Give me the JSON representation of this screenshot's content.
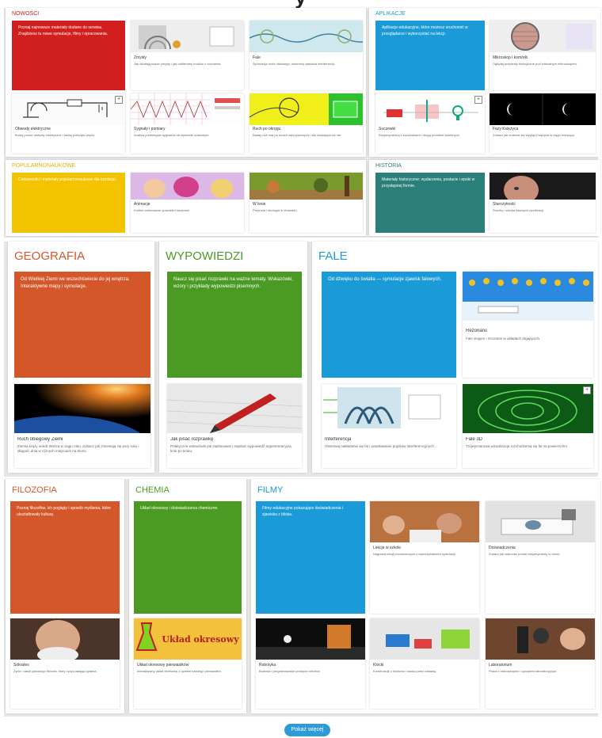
{
  "top_heading": "y",
  "colors": {
    "red": "#d11f1f",
    "blue": "#1a9bd7",
    "yellow": "#f3c300",
    "teal": "#2a7f7a",
    "orange": "#d4572a",
    "green": "#4a9a24",
    "button": "#2f9ad6"
  },
  "row1": {
    "nowosci": {
      "title": "NOWOŚCI",
      "intro": "Poznaj najnowsze materiały dodane do serwisu. Znajdziesz tu nowe symulacje, filmy i opracowania.",
      "cards": [
        {
          "title": "Zmysły",
          "desc": "Jak działają nasze zmysły i jak odbieramy bodźce z otoczenia.",
          "icon": "senses-diagram"
        },
        {
          "title": "Fale",
          "desc": "Symulacja ruchu falowego, obserwuj zjawiska interferencji.",
          "icon": "wave-track"
        },
        {
          "title": "Obwody elektryczne",
          "desc": "Buduj proste obwody elektryczne i badaj przepływ prądu.",
          "icon": "circuit"
        },
        {
          "title": "Sygnały i pomiary",
          "desc": "Analiza przebiegów sygnałów na wykresie czasowym.",
          "icon": "oscilloscope"
        },
        {
          "title": "Ruch po okręgu",
          "desc": "Badaj ruch ciał po torach zakrzywionych i siły działające na nie.",
          "icon": "circle-motion"
        }
      ]
    },
    "aplikacje": {
      "title": "APLIKACJE",
      "intro": "Aplikacje edukacyjne, które możesz uruchomić w przeglądarce i wykorzystać na lekcji.",
      "cards": [
        {
          "title": "Mikroskop i komórki",
          "desc": "Oglądaj preparaty biologiczne pod wirtualnym mikroskopem.",
          "icon": "microscope-view"
        },
        {
          "title": "Soczewki",
          "desc": "Eksperymentuj z soczewkami i drogą promieni świetlnych.",
          "icon": "optics"
        },
        {
          "title": "Fazy Księżyca",
          "desc": "Zobacz jak zmienia się wygląd Księżyca w ciągu miesiąca.",
          "icon": "moon-phases"
        }
      ]
    },
    "popularnonaukowe": {
      "title": "POPULARNONAUKOWE",
      "intro": "Ciekawostki i materiały popularnonaukowe dla każdego.",
      "cards": [
        {
          "title": "Animacje",
          "desc": "Krótkie animowane opowieści naukowe.",
          "icon": "cartoon"
        },
        {
          "title": "W lesie",
          "desc": "Przyroda i ekologia w obrazach.",
          "icon": "forest-scene"
        }
      ]
    },
    "historia": {
      "title": "HISTORIA",
      "intro": "Materiały historyczne: wydarzenia, postacie i epoki w przystępnej formie.",
      "cards": [
        {
          "title": "Starożytność",
          "desc": "Rzeźby i sztuka dawnych cywilizacji.",
          "icon": "statue-face"
        }
      ]
    }
  },
  "row2": {
    "geografia": {
      "title": "GEOGRAFIA",
      "intro": "Od Wielkiej Ziemi we wszechświecie do jej wnętrza. Interaktywne mapy i symulacje.",
      "cards": [
        {
          "title": "Ruch obiegowy Ziemi",
          "desc": "Ziemia krąży wokół Słońca w ciągu roku. Zobacz jak zmieniają się pory roku i długość dnia w różnych miejscach na Ziemi.",
          "icon": "earth-from-space"
        }
      ]
    },
    "wypowiedzi": {
      "title": "WYPOWIEDZI",
      "intro": "Naucz się pisać rozprawki na ważne tematy. Wskazówki, wzory i przykłady wypowiedzi pisemnych.",
      "cards": [
        {
          "title": "Jak pisać rozprawkę",
          "desc": "Praktyczne wskazówki jak zaplanować i napisać wypowiedź argumentacyjną krok po kroku.",
          "icon": "pen-paper"
        }
      ]
    },
    "fale": {
      "title": "FALE",
      "intro": "Od dźwięku do światła — symulacje zjawisk falowych.",
      "cards": [
        {
          "title": "Interferencja",
          "desc": "Obserwuj nakładanie się fal i powstawanie prążków interferencyjnych.",
          "icon": "interference-demo"
        },
        {
          "title": "Rezonans",
          "desc": "Fale stojące i rezonans w układach drgających.",
          "icon": "pendulum-row"
        },
        {
          "title": "Fale 3D",
          "desc": "Trójwymiarowa wizualizacja rozchodzenia się fal na powierzchni.",
          "icon": "green-rings"
        }
      ]
    }
  },
  "row3": {
    "filozofia": {
      "title": "FILOZOFIA",
      "intro": "Poznaj filozofów, ich poglądy i sposób myślenia, które ukształtowały kulturę.",
      "cards": [
        {
          "title": "Sokrates",
          "desc": "Życie i nauki greckiego filozofa, który uczył zadając pytania.",
          "icon": "philosopher-portrait"
        }
      ]
    },
    "chemia": {
      "title": "CHEMIA",
      "intro": "Układ okresowy i doświadczenia chemiczne.",
      "cards": [
        {
          "title": "Układ okresowy pierwiastków",
          "desc": "Interaktywny układ okresowy z opisem każdego pierwiastka.",
          "icon": "periodic-table",
          "image_text": "Układ okresowy"
        }
      ]
    },
    "filmy": {
      "title": "FILMY",
      "intro": "Filmy edukacyjne pokazujące doświadczenia i zjawiska z bliska.",
      "cards": [
        {
          "title": "Lekcje w szkole",
          "desc": "Nagrania lekcji prowadzonych z wykorzystaniem symulacji.",
          "icon": "classroom"
        },
        {
          "title": "Doświadczenia",
          "desc": "Zobacz jak wykonać proste eksperymenty w domu.",
          "icon": "lab-work"
        },
        {
          "title": "Robotyka",
          "desc": "Budowa i programowanie prostych robotów.",
          "icon": "robot-parts"
        },
        {
          "title": "Laboratorium",
          "desc": "Praca z mikroskopem i sprzętem laboratoryjnym.",
          "icon": "microscope-girl"
        },
        {
          "title": "Klocki",
          "desc": "Konstrukcje z klocków i nauka przez zabawę.",
          "icon": "blocks"
        }
      ]
    }
  },
  "more_button": "Pokaż więcej"
}
